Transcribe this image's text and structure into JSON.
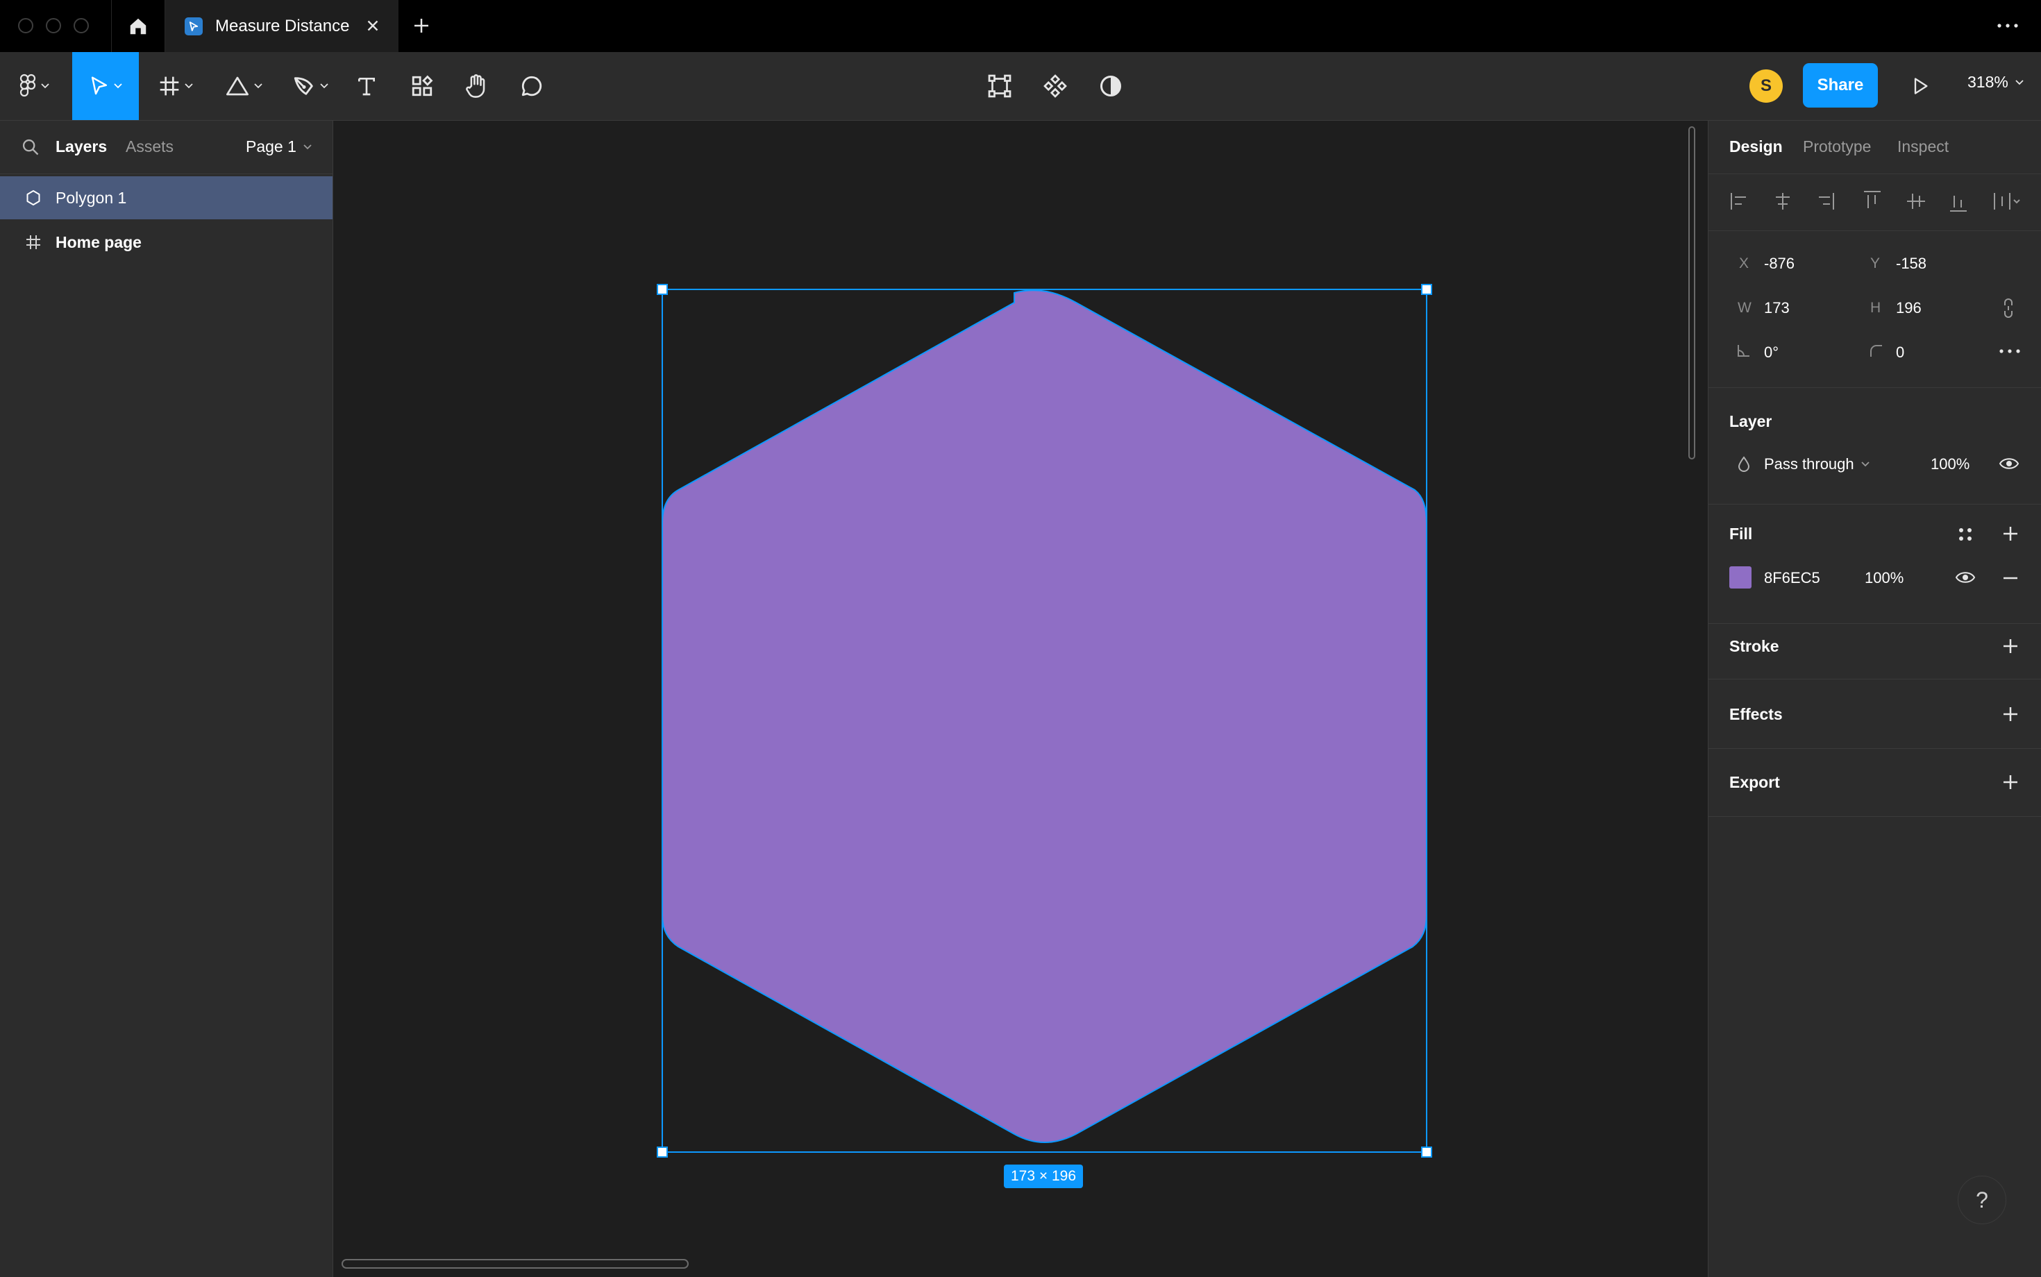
{
  "titlebar": {
    "document_tab": "Measure Distance"
  },
  "toolbar": {
    "avatar_initial": "S",
    "share_label": "Share",
    "zoom": "318%"
  },
  "left_panel": {
    "tabs": [
      "Layers",
      "Assets"
    ],
    "page": "Page 1",
    "layers": [
      {
        "name": "Polygon 1",
        "icon": "polygon-icon",
        "selected": true
      },
      {
        "name": "Home page",
        "icon": "frame-icon",
        "selected": false
      }
    ]
  },
  "canvas": {
    "selection_size": "173 × 196",
    "shape_fill": "#8F6EC5",
    "selection_color": "#0d99ff"
  },
  "right_panel": {
    "tabs": [
      "Design",
      "Prototype",
      "Inspect"
    ],
    "props": {
      "x_label": "X",
      "x": "-876",
      "y_label": "Y",
      "y": "-158",
      "w_label": "W",
      "w": "173",
      "h_label": "H",
      "h": "196",
      "rotation": "0°",
      "radius": "0"
    },
    "layer": {
      "title": "Layer",
      "blend_mode": "Pass through",
      "opacity": "100%"
    },
    "fill": {
      "title": "Fill",
      "hex": "8F6EC5",
      "color": "#8F6EC5",
      "opacity": "100%"
    },
    "stroke_title": "Stroke",
    "effects_title": "Effects",
    "export_title": "Export",
    "help": "?"
  }
}
